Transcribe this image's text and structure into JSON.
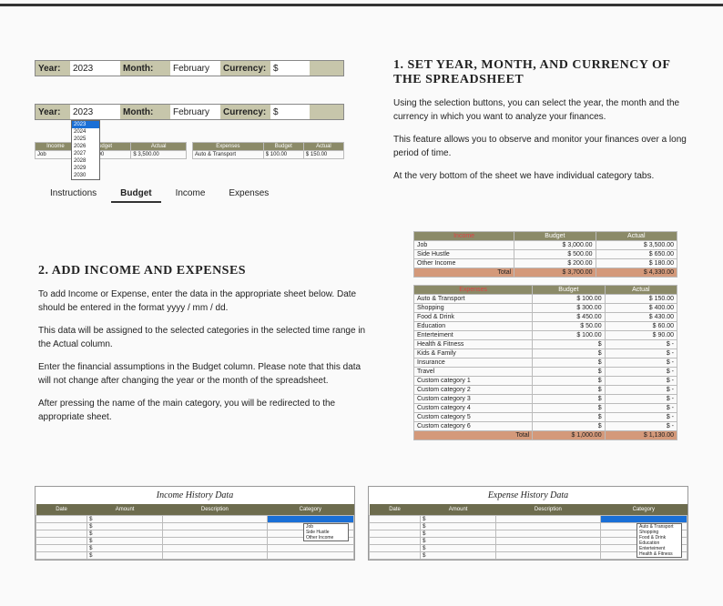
{
  "ribbon": {
    "year_label": "Year:",
    "year_value": "2023",
    "month_label": "Month:",
    "month_value": "February",
    "currency_label": "Currency:",
    "currency_value": "$"
  },
  "year_dropdown": [
    "2023",
    "2024",
    "2025",
    "2026",
    "2027",
    "2028",
    "2029",
    "2030"
  ],
  "mini_left": {
    "h1": "Income",
    "h2": "Budget",
    "h3": "Actual",
    "row_label": "Job",
    "b": "3,000.00",
    "a": "3,500.00",
    "cur": "$"
  },
  "mini_right": {
    "h1": "Expenses",
    "h2": "Budget",
    "h3": "Actual",
    "row_label": "Auto & Transport",
    "b": "100.00",
    "a": "150.00",
    "cur": "$"
  },
  "tabs": [
    "Instructions",
    "Budget",
    "Income",
    "Expenses"
  ],
  "section1": {
    "title": "1. SET YEAR, MONTH, AND CURRENCY OF THE SPREADSHEET",
    "p1": "Using the selection buttons, you can select the year, the month and the currency in which you want to analyze your finances.",
    "p2": "This feature allows you to observe and monitor your finances over a long period of time.",
    "p3": "At the very bottom of the sheet we have individual category tabs."
  },
  "section2": {
    "title": "2. ADD INCOME AND EXPENSES",
    "p1": "To add Income or Expense, enter the data in the appropriate sheet below. Date should be entered in the format yyyy / mm / dd.",
    "p2": "This data will be assigned to the selected categories in the selected time range in the Actual column.",
    "p3": "Enter the financial assumptions in the Budget column. Please note that this data will not change after changing the year or the month of the spreadsheet.",
    "p4": "After pressing the name of the main category, you will be redirected to the appropriate sheet."
  },
  "income_table": {
    "headers": [
      "Income",
      "Budget",
      "Actual"
    ],
    "rows": [
      {
        "label": "Job",
        "b": "3,000.00",
        "a": "3,500.00"
      },
      {
        "label": "Side Hustle",
        "b": "500.00",
        "a": "650.00"
      },
      {
        "label": "Other Income",
        "b": "200.00",
        "a": "180.00"
      }
    ],
    "total_label": "Total",
    "total_b": "3,700.00",
    "total_a": "4,330.00",
    "cur": "$"
  },
  "expense_table": {
    "headers": [
      "Expenses",
      "Budget",
      "Actual"
    ],
    "rows": [
      {
        "label": "Auto & Transport",
        "b": "100.00",
        "a": "150.00"
      },
      {
        "label": "Shopping",
        "b": "300.00",
        "a": "400.00"
      },
      {
        "label": "Food & Drink",
        "b": "450.00",
        "a": "430.00"
      },
      {
        "label": "Education",
        "b": "50.00",
        "a": "60.00"
      },
      {
        "label": "Enterteiment",
        "b": "100.00",
        "a": "90.00"
      },
      {
        "label": "Health & Fitness",
        "b": "",
        "a": "-"
      },
      {
        "label": "Kids & Family",
        "b": "",
        "a": "-"
      },
      {
        "label": "Insurance",
        "b": "",
        "a": "-"
      },
      {
        "label": "Travel",
        "b": "",
        "a": "-"
      },
      {
        "label": "Custom category 1",
        "b": "",
        "a": "-"
      },
      {
        "label": "Custom category 2",
        "b": "",
        "a": "-"
      },
      {
        "label": "Custom category 3",
        "b": "",
        "a": "-"
      },
      {
        "label": "Custom category 4",
        "b": "",
        "a": "-"
      },
      {
        "label": "Custom category 5",
        "b": "",
        "a": "-"
      },
      {
        "label": "Custom category 6",
        "b": "",
        "a": "-"
      }
    ],
    "total_label": "Total",
    "total_b": "1,000.00",
    "total_a": "1,130.00",
    "cur": "$"
  },
  "history_headers": [
    "Date",
    "Amount",
    "Description",
    "Category"
  ],
  "history_left_title": "Income History Data",
  "history_right_title": "Expense History Data",
  "income_cats": [
    "Job",
    "Side Hustle",
    "Other Income"
  ],
  "expense_cats": [
    "Auto & Transport",
    "Shopping",
    "Food & Drink",
    "Education",
    "Enterteiment",
    "Health & Fitness"
  ],
  "cur": "$"
}
